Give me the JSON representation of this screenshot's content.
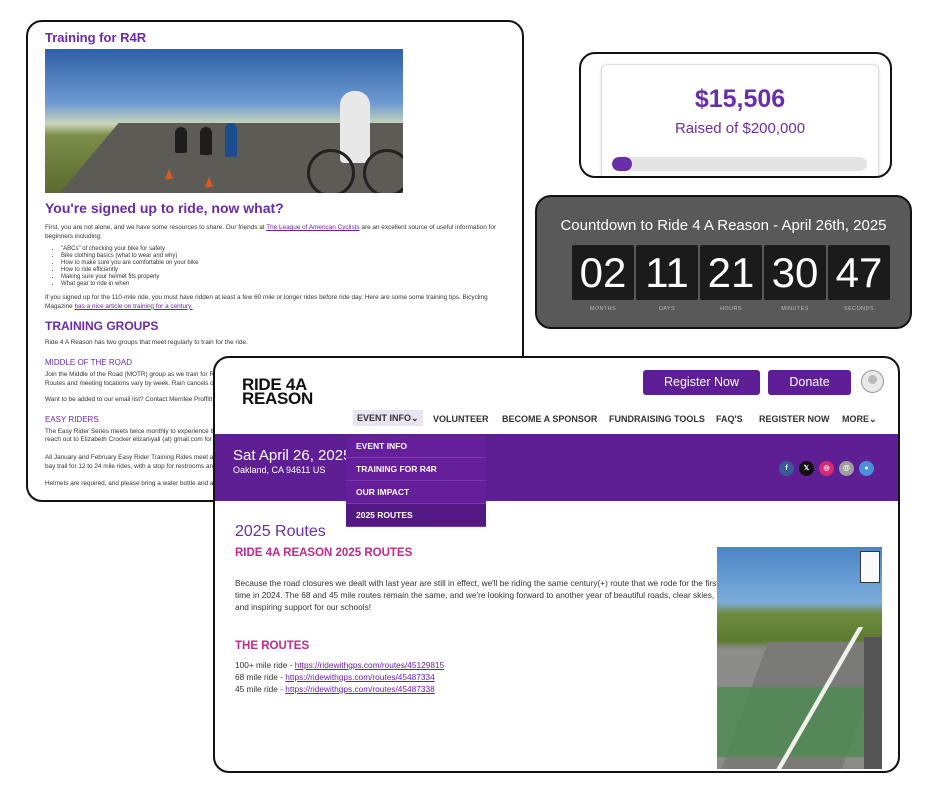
{
  "training": {
    "title": "Training for R4R",
    "heading": "You're signed up to ride, now what?",
    "intro_a": "First, you are not alone, and we have some resources to share. Our friends at ",
    "intro_link": "The League of American Cyclists",
    "intro_b": " are an excellent source of useful information for beginners including:",
    "bullets": [
      "\"ABCs\" of checking your bike for safety",
      "Bike clothing basics (what to wear and why)",
      "How to make sure you are comfortable on your bike",
      "How to ride efficiently",
      "Making sure your helmet fits properly",
      "What gear to ride in when"
    ],
    "para2_a": "If you signed up for the 110-mile ride, you must have ridden at least a few 60 mile or longer rides before ride day. Here are some some training tips.  Bicycling Magazine ",
    "para2_link": "has a nice article on training for a century.",
    "groups_heading": "TRAINING GROUPS",
    "groups_text": "Ride 4 A Reason has two groups that meet regularly to train for the ride.",
    "motr_heading": "MIDDLE OF THE ROAD",
    "motr_text1": "Join the Middle of the Road (MOTR) group as we train for Ride",
    "motr_text2": " Routes and meeting locations vary by week. Rain cancels or r",
    "email_text": "Want to be added to our email list? Contact Merrilee Proffitt m",
    "easy_heading": "EASY RIDERS",
    "easy_text1": "The Easy Rider Series meets twice monthly to experience the J",
    "easy_text2": "reach out to Elizabeth Crocker elizaniyali (at) gmail.com for m",
    "jan_text1": "All January and February Easy Rider Training Rides meet at the",
    "jan_text2": "bay trail for 12 to 24 mile rides, with a stop for restrooms and",
    "helmet_text": "Helmets are required, and please bring a water bottle and a sn"
  },
  "fundraising": {
    "amount": "$15,506",
    "raised_of": "Raised of $200,000",
    "progress_fraction": 0.0775
  },
  "countdown": {
    "title": "Countdown to Ride 4 A Reason - April 26th, 2025",
    "units": [
      {
        "value": "02",
        "label": "MONTHS"
      },
      {
        "value": "11",
        "label": "DAYS"
      },
      {
        "value": "21",
        "label": "HOURS"
      },
      {
        "value": "30",
        "label": "MINUTES"
      },
      {
        "value": "47",
        "label": "SECONDS"
      }
    ]
  },
  "routes_page": {
    "logo_line1": "RIDE 4A",
    "logo_line2": "REASON",
    "register_button": "Register Now",
    "donate_button": "Donate",
    "nav": {
      "event_info": "EVENT INFO",
      "volunteer": "VOLUNTEER",
      "sponsor": "BECOME A SPONSOR",
      "tools": "FUNDRAISING TOOLS",
      "faqs": "FAQ'S",
      "register": "REGISTER NOW",
      "more": "MORE"
    },
    "dropdown": [
      "EVENT INFO",
      "TRAINING FOR R4R",
      "OUR IMPACT",
      "2025 ROUTES"
    ],
    "event_date": "Sat April 26, 2025",
    "event_location": "Oakland, CA 94611 US",
    "social_colors": {
      "facebook": "#3b5998",
      "x": "#111111",
      "instagram": "#d62976",
      "email": "#9e9e9e",
      "chat": "#4a90d9"
    },
    "page_title": "2025 Routes",
    "subtitle": "RIDE 4A REASON 2025 ROUTES",
    "body": "Because the road closures we dealt with last year are still in effect, we'll be riding the same century(+) route that we rode for the first time in 2024.  The 68 and 45 mile routes remain the same, and we're looking forward to another year of beautiful roads, clear skies, and inspiring support for our schools!",
    "routes_heading": "THE ROUTES",
    "routes": [
      {
        "label": "100+ mile ride - ",
        "url": "https://ridewithgps.com/routes/45129815"
      },
      {
        "label": "68 mile ride - ",
        "url": "https://ridewithgps.com/routes/45487334"
      },
      {
        "label": "45 mile ride - ",
        "url": "https://ridewithgps.com/routes/45487338"
      }
    ]
  }
}
